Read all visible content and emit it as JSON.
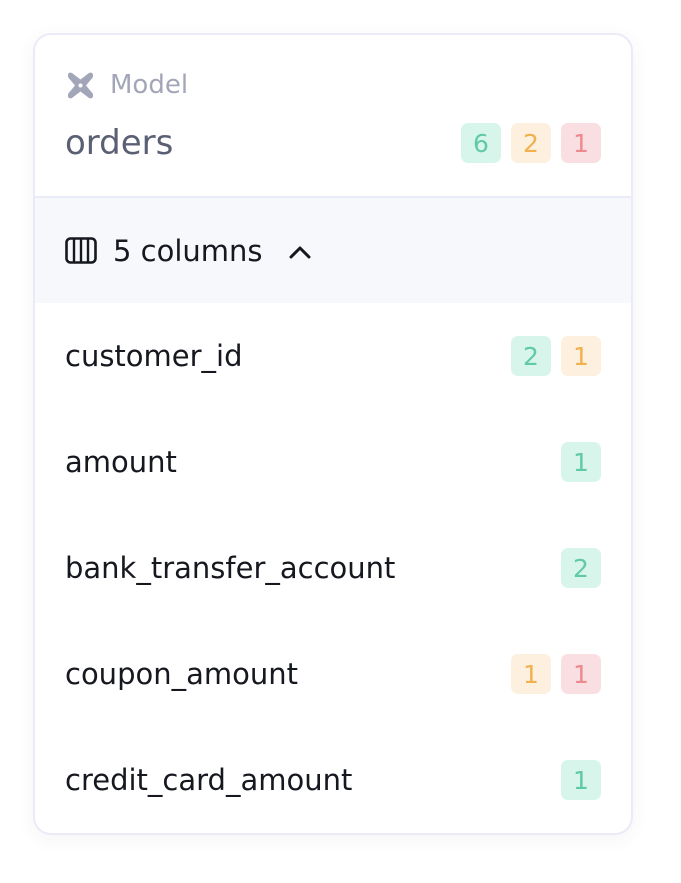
{
  "model": {
    "type_label": "Model",
    "icon": "dbt-model-icon",
    "name": "orders",
    "badges": [
      {
        "value": "6",
        "status": "green"
      },
      {
        "value": "2",
        "status": "yellow"
      },
      {
        "value": "1",
        "status": "red"
      }
    ]
  },
  "columns_section": {
    "icon": "columns-icon",
    "label": "5 columns",
    "expanded_icon": "chevron-up-icon"
  },
  "columns": [
    {
      "name": "customer_id",
      "badges": [
        {
          "value": "2",
          "status": "green"
        },
        {
          "value": "1",
          "status": "yellow"
        }
      ]
    },
    {
      "name": "amount",
      "badges": [
        {
          "value": "1",
          "status": "green"
        }
      ]
    },
    {
      "name": "bank_transfer_account",
      "badges": [
        {
          "value": "2",
          "status": "green"
        }
      ]
    },
    {
      "name": "coupon_amount",
      "badges": [
        {
          "value": "1",
          "status": "yellow"
        },
        {
          "value": "1",
          "status": "red"
        }
      ]
    },
    {
      "name": "credit_card_amount",
      "badges": [
        {
          "value": "1",
          "status": "green"
        }
      ]
    }
  ],
  "colors": {
    "green_bg": "#d8f5eb",
    "green_fg": "#5fcaa3",
    "yellow_bg": "#fdf0de",
    "yellow_fg": "#f0b14e",
    "red_bg": "#f9dfe1",
    "red_fg": "#ec8a8f"
  }
}
